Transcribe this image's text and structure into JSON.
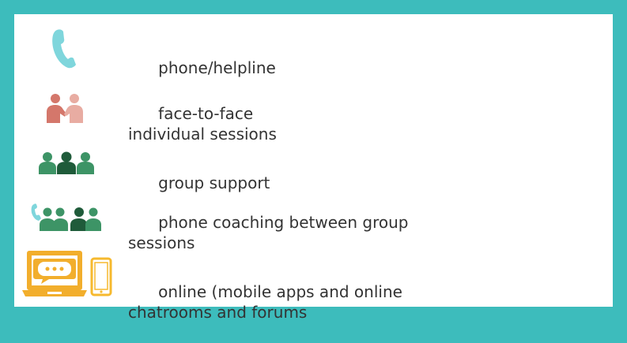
{
  "legend": {
    "items": [
      {
        "id": "phone",
        "icon": "phone-icon",
        "lines": [
          "phone/helpline"
        ]
      },
      {
        "id": "face",
        "icon": "face-to-face-icon",
        "lines": [
          "face-to-face",
          "individual sessions"
        ]
      },
      {
        "id": "group",
        "icon": "group-icon",
        "lines": [
          "group support"
        ]
      },
      {
        "id": "coaching",
        "icon": "phone-coaching-icon",
        "lines": [
          "phone coaching between group",
          "sessions"
        ]
      },
      {
        "id": "online",
        "icon": "online-devices-icon",
        "lines": [
          "online (mobile apps and online",
          "chatrooms and forums"
        ]
      }
    ]
  },
  "colors": {
    "border": "#3dbcbc",
    "phone": "#7fd6dc",
    "face_dark": "#d4776b",
    "face_light": "#e8aca2",
    "group_light": "#3d9466",
    "group_dark": "#1f5b3a",
    "online_orange": "#f2ae2c",
    "online_outline": "#f6b92e",
    "text": "#333333"
  }
}
